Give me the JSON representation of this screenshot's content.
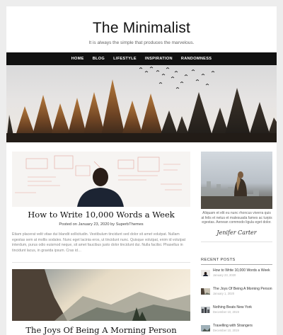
{
  "site": {
    "title": "The Minimalist",
    "tagline": "It is always the simple that produces the marvelous."
  },
  "nav": {
    "items": [
      {
        "label": "HOME"
      },
      {
        "label": "BLOG"
      },
      {
        "label": "LIFESTYLE"
      },
      {
        "label": "INSPIRATION"
      },
      {
        "label": "RANDOMNESS"
      }
    ]
  },
  "posts": [
    {
      "title": "How to Write 10,000 Words a Week",
      "meta_prefix": "Posted on",
      "date": "January 23, 2020",
      "meta_by": "by",
      "author": "SuperbThemes",
      "excerpt": "Etiam placerat velit vitae dui blandit sollicitudin. Vestibulum tincidunt sed dolor sit amet volutpat. Nullam egestas sem at mollis sodales. Nunc eget lacinia eros, ut tincidunt nunc. Quisque volutpat, enim id volutpat interdum, purus odio euismod neque, sit amet faucibus justo dolor tincidunt dui. Nulla facilisi. Phasellus in tincidunt lacus, in gravida ipsum. Cras id…"
    },
    {
      "title": "The Joys Of Being A Morning Person"
    }
  ],
  "sidebar": {
    "caption": "Aliquam et elit eu nunc rhoncus viverra quis at felis et netus et malesuada fames ac turpis egestas. Aenean commodo ligula eget dolor.",
    "signature": "Jenifer Carter",
    "recent_heading": "RECENT POSTS",
    "recent": [
      {
        "title": "How to Write 10,000 Words a Week",
        "date": "January 23, 2020"
      },
      {
        "title": "The Joys Of Being A Morning Person",
        "date": "January 1, 2020"
      },
      {
        "title": "Nothing Beats New York",
        "date": "December 10, 2019"
      },
      {
        "title": "Travelling with Strangers",
        "date": "December 10, 2019"
      }
    ]
  },
  "colors": {
    "nav_bg": "#111111",
    "page_bg": "#ededed",
    "accent_text": "#111111"
  }
}
